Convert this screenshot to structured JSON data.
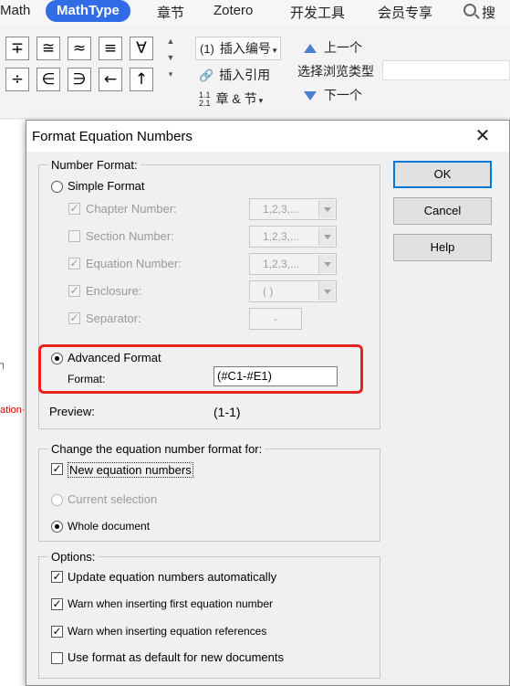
{
  "ribbon_tabs": {
    "items": [
      "Math",
      "MathType",
      "章节",
      "Zotero",
      "开发工具",
      "会员专享"
    ],
    "active": "MathType",
    "search_label": "搜"
  },
  "ribbon": {
    "symbols_row1": [
      "∓",
      "≅",
      "≈",
      "≡",
      "∀"
    ],
    "symbols_row2": [
      "÷",
      "∈",
      "∋",
      "←",
      "↑"
    ],
    "insert_number_icon": "(1)",
    "insert_number": "插入编号",
    "insert_ref": "插入引用",
    "chapter_icon": "1.1\n2.1",
    "chapter_section": "章 & 节",
    "prev": "上一个",
    "browse_type": "选择浏览类型",
    "next": "下一个"
  },
  "doc": {
    "mark1": "┐",
    "mark2": "ation·"
  },
  "dialog": {
    "title": "Format Equation Numbers",
    "number_format_label": "Number Format:",
    "simple_format": "Simple Format",
    "chapter_number": "Chapter Number:",
    "chapter_number_value": "1,2,3,...",
    "section_number": "Section Number:",
    "section_number_value": "1,2,3,...",
    "equation_number": "Equation Number:",
    "equation_number_value": "1,2,3,...",
    "enclosure": "Enclosure:",
    "enclosure_value": "( )",
    "separator": "Separator:",
    "separator_value": "-",
    "advanced_format": "Advanced Format",
    "format_label": "Format:",
    "format_value": "(#C1-#E1)",
    "preview_label": "Preview:",
    "preview_value": "(1-1)",
    "change_label": "Change the equation number format for:",
    "new_equations": "New equation numbers",
    "current_selection": "Current selection",
    "whole_document": "Whole document",
    "options_label": "Options:",
    "opt_update": "Update equation numbers automatically",
    "opt_warn_first": "Warn when inserting first equation number",
    "opt_warn_refs": "Warn when inserting equation references",
    "opt_default": "Use format as default for new documents",
    "ok": "OK",
    "cancel": "Cancel",
    "help": "Help",
    "check_mark": "✓"
  },
  "colors": {
    "accent": "#2f6ce5",
    "highlight": "#e8231b"
  }
}
